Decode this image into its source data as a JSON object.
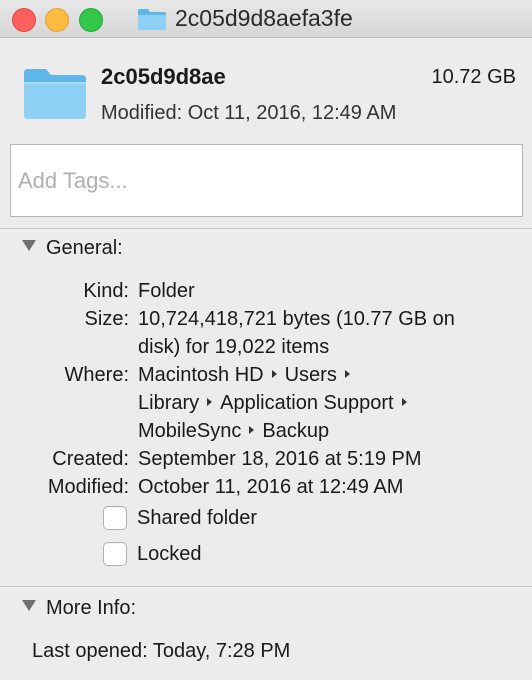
{
  "window": {
    "title": "2c05d9d8aefa3fe"
  },
  "header": {
    "name": "2c05d9d8ae",
    "size": "10.72 GB",
    "modified": "Modified: Oct 11, 2016, 12:49 AM"
  },
  "tags": {
    "placeholder": "Add Tags..."
  },
  "general": {
    "title": "General:",
    "kind_label": "Kind:",
    "kind_value": "Folder",
    "size_label": "Size:",
    "size_value_1": "10,724,418,721 bytes (10.77 GB on",
    "size_value_2": "disk) for 19,022 items",
    "where_label": "Where:",
    "where_path": [
      "Macintosh HD",
      "Users",
      "Library",
      "Application Support",
      "MobileSync",
      "Backup"
    ],
    "created_label": "Created:",
    "created_value": "September 18, 2016 at 5:19 PM",
    "modified_label": "Modified:",
    "modified_value": "October 11, 2016 at 12:49 AM",
    "shared_folder": "Shared folder",
    "shared_folder_checked": false,
    "locked": "Locked",
    "locked_checked": false
  },
  "more_info": {
    "title": "More Info:",
    "last_opened": "Last opened: Today, 7:28 PM"
  },
  "icons": {
    "folder": "folder-icon",
    "disclosure": "disclosure-triangle-icon",
    "path_separator": "path-arrow-icon"
  },
  "colors": {
    "folder_light": "#8fd1f5",
    "folder_dark": "#5fb6e8",
    "close": "#fc605c",
    "minimize": "#fdbc40",
    "maximize": "#34c84a"
  }
}
